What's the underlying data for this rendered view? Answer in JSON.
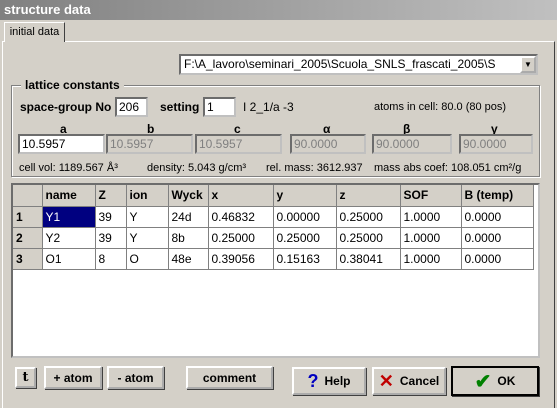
{
  "window": {
    "title": "structure data"
  },
  "tabs": [
    {
      "label": "initial data"
    }
  ],
  "file": {
    "path": "F:\\A_lavoro\\seminari_2005\\Scuola_SNLS_frascati_2005\\S"
  },
  "lattice": {
    "title": "lattice constants",
    "spacegroup_label": "space-group No",
    "spacegroup_value": "206",
    "setting_label": "setting",
    "setting_value": "1",
    "symbol": "I 2_1/a -3",
    "atoms_in_cell": "atoms in cell: 80.0   (80 pos)",
    "param_labels": [
      "a",
      "b",
      "c",
      "α",
      "β",
      "γ"
    ],
    "param_values": [
      "10.5957",
      "10.5957",
      "10.5957",
      "90.0000",
      "90.0000",
      "90.0000"
    ],
    "cell_vol": "cell vol: 1189.567 Å³",
    "density": "density: 5.043 g/cm³",
    "rel_mass": "rel. mass: 3612.937",
    "mass_abs": "mass abs coef: 108.051 cm²/g"
  },
  "atoms": {
    "headers": [
      "",
      "name",
      "Z",
      "ion",
      "Wyck",
      "x",
      "y",
      "z",
      "SOF",
      "B (temp)"
    ],
    "rows": [
      [
        "1",
        "Y1",
        "39",
        "Y",
        "24d",
        "0.46832",
        "0.00000",
        "0.25000",
        "1.0000",
        "0.0000"
      ],
      [
        "2",
        "Y2",
        "39",
        "Y",
        "8b",
        "0.25000",
        "0.25000",
        "0.25000",
        "1.0000",
        "0.0000"
      ],
      [
        "3",
        "O1",
        "8",
        "O",
        "48e",
        "0.39056",
        "0.15163",
        "0.38041",
        "1.0000",
        "0.0000"
      ]
    ]
  },
  "buttons": {
    "text_icon": "t",
    "add_atom": "+ atom",
    "del_atom": "- atom",
    "comment": "comment",
    "help": "Help",
    "cancel": "Cancel",
    "ok": "OK"
  },
  "colors": {
    "selection": "#000080",
    "help_icon": "#0000c0",
    "cancel_icon": "#c00000",
    "ok_icon": "#008000"
  }
}
